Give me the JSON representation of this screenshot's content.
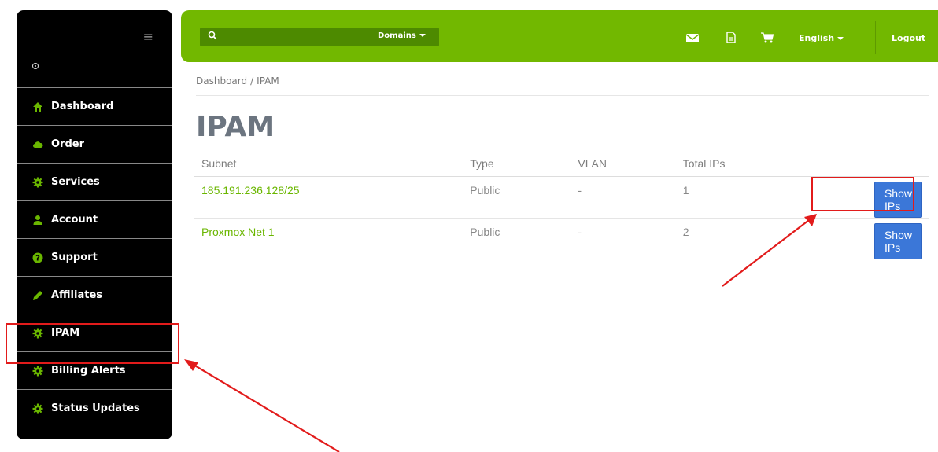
{
  "sidebar": {
    "menu_icon": "hamburger-icon",
    "items": [
      {
        "label": "Dashboard",
        "icon": "home-icon"
      },
      {
        "label": "Order",
        "icon": "cloud-icon"
      },
      {
        "label": "Services",
        "icon": "gear-icon"
      },
      {
        "label": "Account",
        "icon": "user-icon"
      },
      {
        "label": "Support",
        "icon": "question-icon"
      },
      {
        "label": "Affiliates",
        "icon": "pencil-icon"
      },
      {
        "label": "IPAM",
        "icon": "gear-icon"
      },
      {
        "label": "Billing Alerts",
        "icon": "gear-icon"
      },
      {
        "label": "Status Updates",
        "icon": "gear-icon"
      }
    ]
  },
  "topbar": {
    "search_dropdown": "Domains",
    "language": "English",
    "logout": "Logout",
    "icons": [
      "mail-icon",
      "document-icon",
      "cart-icon"
    ],
    "color": "#72b800"
  },
  "breadcrumb": {
    "home": "Dashboard",
    "separator": "/",
    "current": "IPAM"
  },
  "page_title": "IPAM",
  "table": {
    "headers": [
      "Subnet",
      "Type",
      "VLAN",
      "Total IPs"
    ],
    "rows": [
      {
        "subnet": "185.191.236.128/25",
        "type": "Public",
        "vlan": "-",
        "total": "1",
        "action": "Show IPs"
      },
      {
        "subnet": "Proxmox Net 1",
        "type": "Public",
        "vlan": "-",
        "total": "2",
        "action": "Show IPs"
      }
    ]
  },
  "colors": {
    "accent": "#72b800",
    "link": "#6ab600",
    "button": "#3b77d8",
    "annotation": "#e21b1b"
  }
}
